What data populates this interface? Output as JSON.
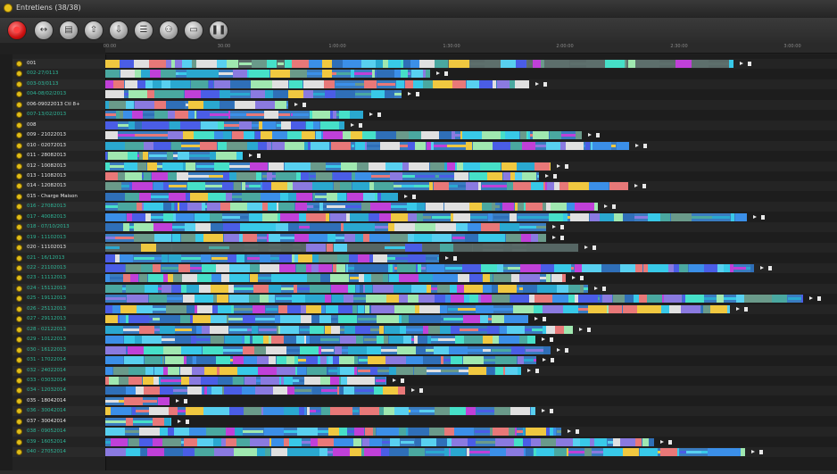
{
  "window": {
    "title": "Entretiens (38/38)"
  },
  "toolbar": {
    "buttons": [
      {
        "name": "record-button",
        "icon": "record-icon",
        "glyph": "●"
      },
      {
        "name": "link-button",
        "icon": "link-icon",
        "glyph": "↔"
      },
      {
        "name": "document-button",
        "icon": "document-icon",
        "glyph": "▤"
      },
      {
        "name": "upload-button",
        "icon": "upload-icon",
        "glyph": "⇧"
      },
      {
        "name": "download-button",
        "icon": "download-icon",
        "glyph": "⇩"
      },
      {
        "name": "list-button",
        "icon": "list-icon",
        "glyph": "☰"
      },
      {
        "name": "users-button",
        "icon": "users-icon",
        "glyph": "⚇"
      },
      {
        "name": "window-button",
        "icon": "window-icon",
        "glyph": "▭"
      },
      {
        "name": "pause-button",
        "icon": "pause-icon",
        "glyph": "❚❚"
      }
    ]
  },
  "timeline": {
    "ticks": [
      "00:00",
      "30:00",
      "1:00:00",
      "1:30:00",
      "2:00:00",
      "2:30:00",
      "3:00:00"
    ]
  },
  "colors": {
    "palette": [
      "#3b8fe8",
      "#38c9e8",
      "#4a5de6",
      "#2f6fb8",
      "#4aa8a0",
      "#6a9a8a",
      "#46e0c8",
      "#c040d8",
      "#e87878",
      "#f0c840",
      "#a0e8b0",
      "#e0e0e0",
      "#58d0f0",
      "#8a7ae0",
      "#2aa8d0"
    ],
    "label_green": "#2fb89a",
    "label_white": "#e6e6e6",
    "accent_icon": "#e0bd1a"
  },
  "rows": [
    {
      "label": "001",
      "label_color": "white"
    },
    {
      "label": "002-27/0113",
      "label_color": "green"
    },
    {
      "label": "003-03/0113",
      "label_color": "green"
    },
    {
      "label": "004-08/02/2013",
      "label_color": "green"
    },
    {
      "label": "006-09022013 Ctl 8+",
      "label_color": "white"
    },
    {
      "label": "007-13/02/2013",
      "label_color": "green"
    },
    {
      "label": "008",
      "label_color": "white"
    },
    {
      "label": "009 - 21022013",
      "label_color": "white"
    },
    {
      "label": "010 - 02072013",
      "label_color": "white"
    },
    {
      "label": "011 - 28082013",
      "label_color": "white"
    },
    {
      "label": "012 - 10082013",
      "label_color": "white"
    },
    {
      "label": "013 - 11082013",
      "label_color": "white"
    },
    {
      "label": "014 - 12082013",
      "label_color": "white"
    },
    {
      "label": "015 - Charge Maison",
      "label_color": "white"
    },
    {
      "label": "016 - 27082013",
      "label_color": "green"
    },
    {
      "label": "017 - 40082013",
      "label_color": "green"
    },
    {
      "label": "018 - 07/10/2013",
      "label_color": "green"
    },
    {
      "label": "019 - 11102013",
      "label_color": "green"
    },
    {
      "label": "020 - 11102013",
      "label_color": "white"
    },
    {
      "label": "021 - 16/12013",
      "label_color": "green"
    },
    {
      "label": "022 - 21102013",
      "label_color": "green"
    },
    {
      "label": "023 - 11112013",
      "label_color": "green"
    },
    {
      "label": "024 - 15112013",
      "label_color": "green"
    },
    {
      "label": "025 - 19112013",
      "label_color": "green"
    },
    {
      "label": "026 - 25112013",
      "label_color": "green"
    },
    {
      "label": "027 - 29112013",
      "label_color": "green"
    },
    {
      "label": "028 - 02122013",
      "label_color": "green"
    },
    {
      "label": "029 - 10122013",
      "label_color": "green"
    },
    {
      "label": "030 - 16122013",
      "label_color": "green"
    },
    {
      "label": "031 - 17022014",
      "label_color": "green"
    },
    {
      "label": "032 - 24022014",
      "label_color": "green"
    },
    {
      "label": "033 - 03032014",
      "label_color": "green"
    },
    {
      "label": "034 - 12032014",
      "label_color": "green"
    },
    {
      "label": "035 - 18042014",
      "label_color": "white"
    },
    {
      "label": "036 - 30042014",
      "label_color": "green"
    },
    {
      "label": "037 - 30042014",
      "label_color": "white"
    },
    {
      "label": "038 - 09052014",
      "label_color": "green"
    },
    {
      "label": "039 - 16052014",
      "label_color": "green"
    },
    {
      "label": "040 - 27052014",
      "label_color": "green"
    }
  ]
}
